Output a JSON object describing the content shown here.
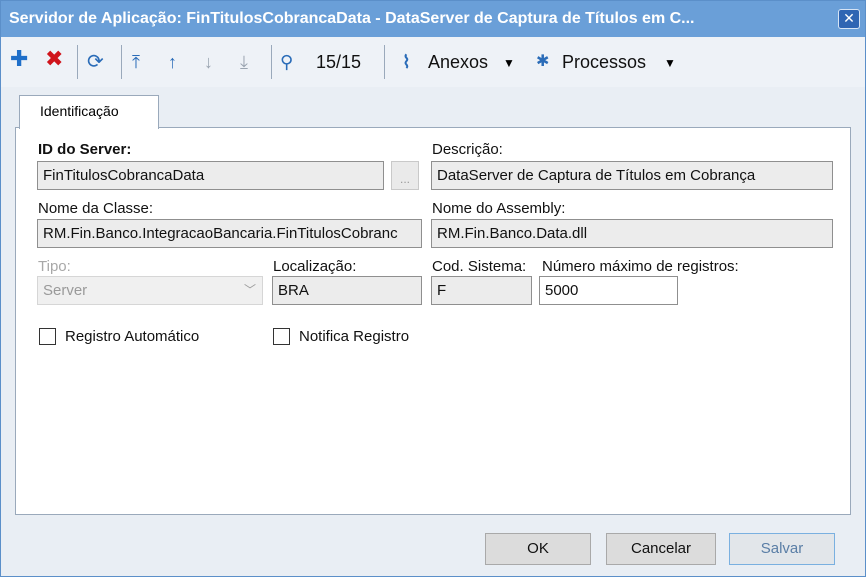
{
  "window": {
    "title": "Servidor de Aplicação: FinTitulosCobrancaData - DataServer de Captura de Títulos em C...",
    "close_label": "✕"
  },
  "toolbar": {
    "record_counter": "15/15",
    "attachments_label": "Anexos",
    "processes_label": "Processos",
    "icons": [
      "add-icon",
      "delete-icon",
      "refresh-icon",
      "first-record-icon",
      "previous-record-icon",
      "next-record-icon",
      "last-record-icon",
      "search-icon",
      "attachments-icon",
      "processes-icon"
    ]
  },
  "tabs": [
    {
      "label": "Identificação",
      "active": true
    }
  ],
  "form": {
    "id_label": "ID do Server:",
    "id_value": "FinTitulosCobrancaData",
    "ellipsis_label": "...",
    "description_label": "Descrição:",
    "description_value": "DataServer de Captura de Títulos em Cobrança",
    "class_label": "Nome da Classe:",
    "class_value": "RM.Fin.Banco.IntegracaoBancaria.FinTitulosCobranc",
    "assembly_label": "Nome do Assembly:",
    "assembly_value": "RM.Fin.Banco.Data.dll",
    "type_label": "Tipo:",
    "type_value": "Server",
    "location_label": "Localização:",
    "location_value": "BRA",
    "system_code_label": "Cod. Sistema:",
    "system_code_value": "F",
    "max_records_label": "Número máximo de registros:",
    "max_records_value": "5000",
    "auto_register_label": "Registro Automático",
    "auto_register_checked": false,
    "notify_register_label": "Notifica Registro",
    "notify_register_checked": false
  },
  "buttons": {
    "ok": "OK",
    "cancel": "Cancelar",
    "save": "Salvar"
  },
  "colors": {
    "titlebar": "#6a9fd8",
    "add_icon": "#1f6fc9",
    "delete_icon": "#d0141b",
    "toolbar_icon": "#2a6cb8"
  }
}
